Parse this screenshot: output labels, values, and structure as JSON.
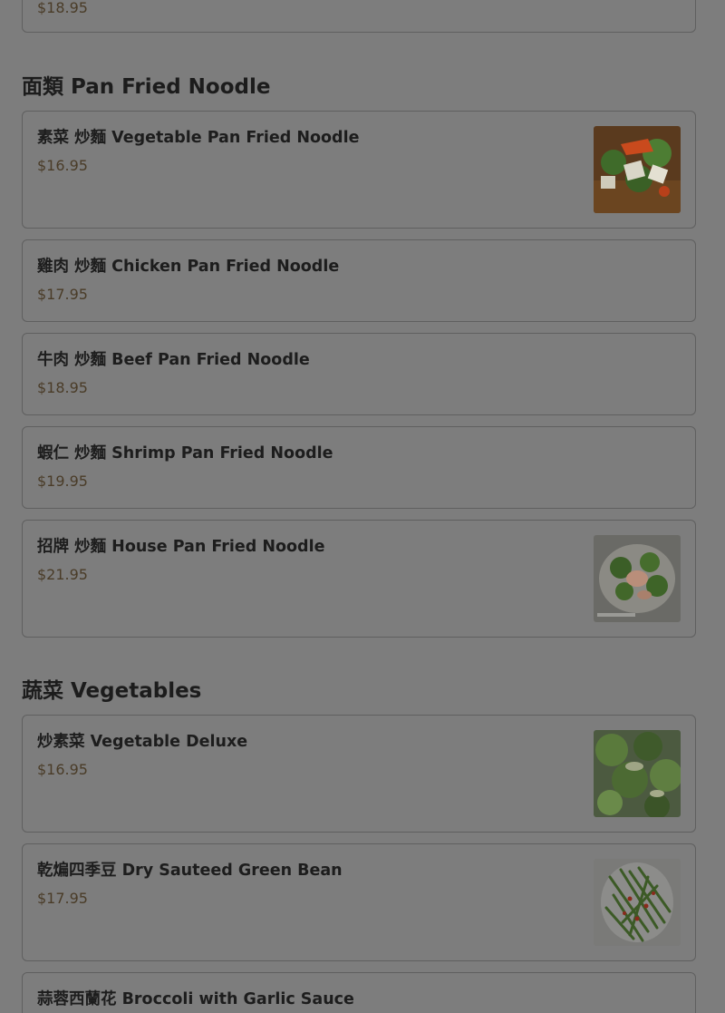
{
  "top_card": {
    "price": "$18.95"
  },
  "sections": [
    {
      "title": "面類 Pan Fried Noodle",
      "items": [
        {
          "name": "素菜 炒麵 Vegetable Pan Fried Noodle",
          "price": "$16.95",
          "image_icon": "vegetable-noodle-photo"
        },
        {
          "name": "雞肉 炒麵 Chicken Pan Fried Noodle",
          "price": "$17.95"
        },
        {
          "name": "牛肉 炒麵 Beef Pan Fried Noodle",
          "price": "$18.95"
        },
        {
          "name": "蝦仁 炒麵 Shrimp Pan Fried Noodle",
          "price": "$19.95"
        },
        {
          "name": "招牌 炒麵 House Pan Fried Noodle",
          "price": "$21.95",
          "image_icon": "house-noodle-photo"
        }
      ]
    },
    {
      "title": "蔬菜 Vegetables",
      "items": [
        {
          "name": "炒素菜 Vegetable Deluxe",
          "price": "$16.95",
          "image_icon": "vegetable-deluxe-photo"
        },
        {
          "name": "乾煸四季豆 Dry Sauteed Green Bean",
          "price": "$17.95",
          "image_icon": "green-bean-photo"
        },
        {
          "name": "蒜蓉西蘭花 Broccoli with Garlic Sauce"
        }
      ]
    }
  ]
}
